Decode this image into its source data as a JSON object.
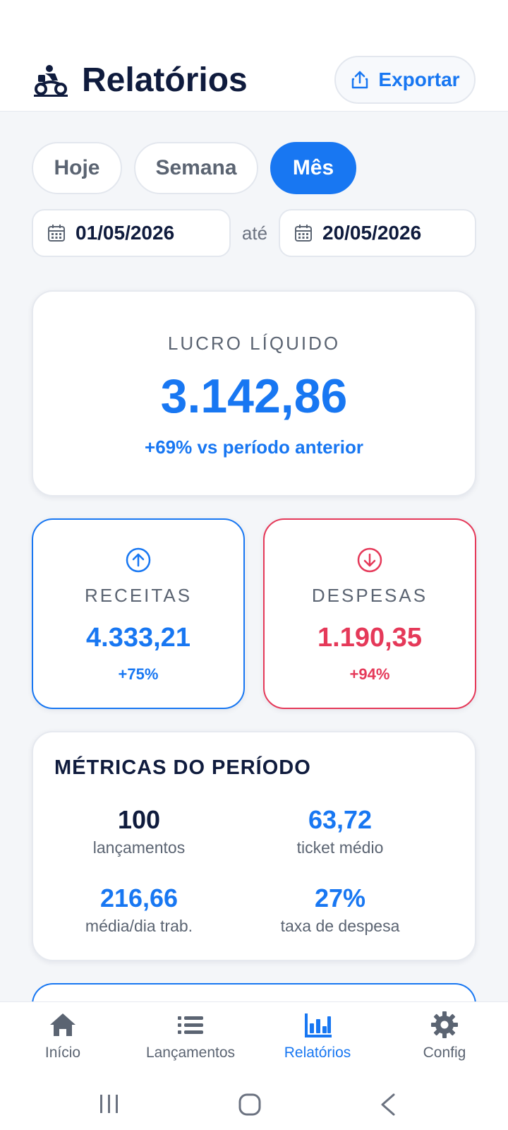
{
  "header": {
    "title": "Relatórios",
    "export_label": "Exportar"
  },
  "period_tabs": [
    {
      "label": "Hoje",
      "active": false
    },
    {
      "label": "Semana",
      "active": false
    },
    {
      "label": "Mês",
      "active": true
    }
  ],
  "date_range": {
    "from": "01/05/2026",
    "separator": "até",
    "to": "20/05/2026"
  },
  "lucro": {
    "label": "LUCRO LÍQUIDO",
    "value": "3.142,86",
    "delta": "+69% vs período anterior"
  },
  "receitas": {
    "label": "RECEITAS",
    "value": "4.333,21",
    "delta": "+75%"
  },
  "despesas": {
    "label": "DESPESAS",
    "value": "1.190,35",
    "delta": "+94%"
  },
  "metrics": {
    "title": "MÉTRICAS DO PERÍODO",
    "items": [
      {
        "value": "100",
        "label": "lançamentos"
      },
      {
        "value": "63,72",
        "label": "ticket médio"
      },
      {
        "value": "216,66",
        "label": "média/dia trab."
      },
      {
        "value": "27%",
        "label": "taxa de despesa"
      }
    ]
  },
  "nav": {
    "items": [
      {
        "label": "Início",
        "icon": "home-icon"
      },
      {
        "label": "Lançamentos",
        "icon": "list-icon"
      },
      {
        "label": "Relatórios",
        "icon": "bar-chart-icon",
        "active": true
      },
      {
        "label": "Config",
        "icon": "gear-icon"
      }
    ]
  },
  "colors": {
    "accent": "#1877f2",
    "expense": "#e53959",
    "text": "#0f1b3d",
    "muted": "#5b6472"
  }
}
